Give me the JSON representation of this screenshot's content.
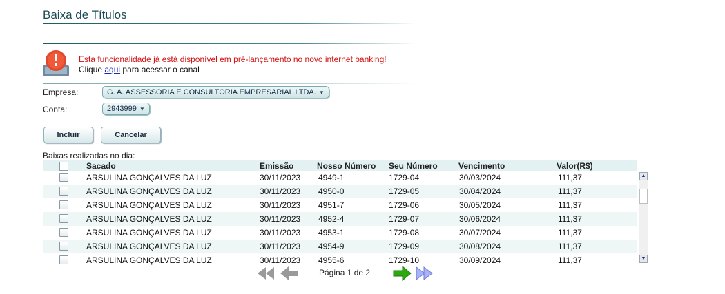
{
  "page": {
    "title": "Baixa de Títulos"
  },
  "alert": {
    "line1": "Esta funcionalidade já está disponível em pré-lançamento no novo internet banking!",
    "line2_prefix": "Clique",
    "line2_link": "aqui",
    "line2_suffix": "para acessar o canal"
  },
  "form": {
    "empresa_label": "Empresa:",
    "empresa_value": "G. A. ASSESSORIA E CONSULTORIA EMPRESARIAL LTDA.",
    "conta_label": "Conta:",
    "conta_value": "2943999"
  },
  "buttons": {
    "incluir": "Incluir",
    "cancelar": "Cancelar"
  },
  "table": {
    "caption": "Baixas realizadas no dia:",
    "headers": {
      "sacado": "Sacado",
      "emissao": "Emissão",
      "nosso_numero": "Nosso Número",
      "seu_numero": "Seu Número",
      "vencimento": "Vencimento",
      "valor": "Valor(R$)"
    },
    "rows": [
      {
        "sacado": "ARSULINA GONÇALVES DA LUZ",
        "emissao": "30/11/2023",
        "nosso_numero": "4949-1",
        "seu_numero": "1729-04",
        "vencimento": "30/03/2024",
        "valor": "111,37"
      },
      {
        "sacado": "ARSULINA GONÇALVES DA LUZ",
        "emissao": "30/11/2023",
        "nosso_numero": "4950-0",
        "seu_numero": "1729-05",
        "vencimento": "30/04/2024",
        "valor": "111,37"
      },
      {
        "sacado": "ARSULINA GONÇALVES DA LUZ",
        "emissao": "30/11/2023",
        "nosso_numero": "4951-7",
        "seu_numero": "1729-06",
        "vencimento": "30/05/2024",
        "valor": "111,37"
      },
      {
        "sacado": "ARSULINA GONÇALVES DA LUZ",
        "emissao": "30/11/2023",
        "nosso_numero": "4952-4",
        "seu_numero": "1729-07",
        "vencimento": "30/06/2024",
        "valor": "111,37"
      },
      {
        "sacado": "ARSULINA GONÇALVES DA LUZ",
        "emissao": "30/11/2023",
        "nosso_numero": "4953-1",
        "seu_numero": "1729-08",
        "vencimento": "30/07/2024",
        "valor": "111,37"
      },
      {
        "sacado": "ARSULINA GONÇALVES DA LUZ",
        "emissao": "30/11/2023",
        "nosso_numero": "4954-9",
        "seu_numero": "1729-09",
        "vencimento": "30/08/2024",
        "valor": "111,37"
      },
      {
        "sacado": "ARSULINA GONÇALVES DA LUZ",
        "emissao": "30/11/2023",
        "nosso_numero": "4955-6",
        "seu_numero": "1729-10",
        "vencimento": "30/09/2024",
        "valor": "111,37"
      }
    ]
  },
  "pager": {
    "text": "Página 1 de 2"
  },
  "colors": {
    "title": "#1d4a57",
    "alert_red": "#d11313",
    "next_green": "#2ea80f",
    "last_lavender": "#aab2f5",
    "disabled_gray": "#9a9a9a"
  },
  "icons": [
    "alert-icon",
    "first-page-icon",
    "previous-page-icon",
    "next-page-icon",
    "last-page-icon",
    "scroll-up-icon",
    "scroll-down-icon"
  ]
}
